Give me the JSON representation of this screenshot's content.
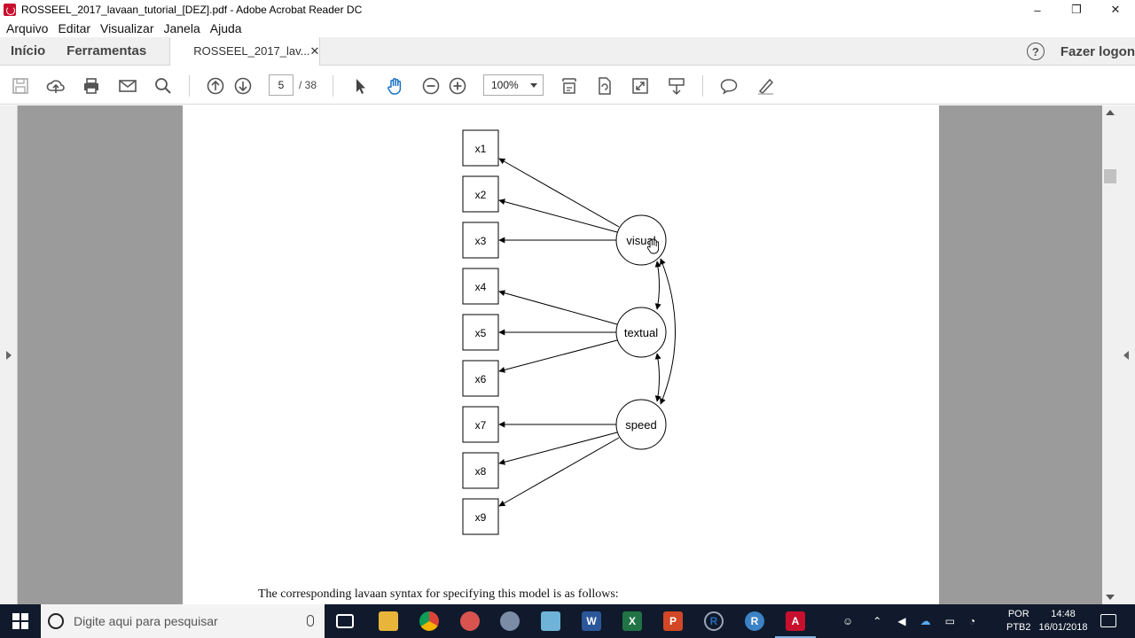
{
  "window": {
    "title": "ROSSEEL_2017_lavaan_tutorial_[DEZ].pdf - Adobe Acrobat Reader DC",
    "minimize": "–",
    "restore": "❐",
    "close": "✕"
  },
  "menu": {
    "items": [
      "Arquivo",
      "Editar",
      "Visualizar",
      "Janela",
      "Ajuda"
    ]
  },
  "tabs": {
    "home": "Início",
    "tools": "Ferramentas",
    "document": "ROSSEEL_2017_lav...",
    "close_glyph": "✕",
    "help": "?",
    "login": "Fazer logon"
  },
  "toolbar": {
    "current_page": "5",
    "total_pages": "/ 38",
    "zoom": "100%",
    "icons": [
      "save-icon",
      "upload-icon",
      "print-icon",
      "email-icon",
      "search-icon",
      "page-up-icon",
      "page-down-icon",
      "select-cursor-icon",
      "hand-icon",
      "zoom-out-icon",
      "zoom-in-icon",
      "fit-page-icon",
      "rotate-icon",
      "fullscreen-icon",
      "scroll-mode-icon",
      "comment-icon",
      "highlight-pen-icon"
    ]
  },
  "diagram": {
    "indicators": [
      "x1",
      "x2",
      "x3",
      "x4",
      "x5",
      "x6",
      "x7",
      "x8",
      "x9"
    ],
    "latents": [
      "visual",
      "textual",
      "speed"
    ],
    "loadings": [
      {
        "from": "visual",
        "to": [
          "x1",
          "x2",
          "x3"
        ]
      },
      {
        "from": "textual",
        "to": [
          "x4",
          "x5",
          "x6"
        ]
      },
      {
        "from": "speed",
        "to": [
          "x7",
          "x8",
          "x9"
        ]
      }
    ],
    "covariances": [
      [
        "visual",
        "textual"
      ],
      [
        "textual",
        "speed"
      ],
      [
        "visual",
        "speed"
      ]
    ]
  },
  "caption": "The corresponding lavaan syntax for specifying this model is as follows:",
  "taskbar": {
    "search_placeholder": "Digite aqui para pesquisar",
    "apps": [
      "task-view-icon",
      "file-explorer-icon",
      "chrome-icon",
      "app-icon-1",
      "app-icon-2",
      "app-icon-3",
      "word-icon",
      "excel-icon",
      "powerpoint-icon",
      "r-icon",
      "rstudio-icon",
      "acrobat-icon"
    ],
    "lang_top": "POR",
    "lang_bottom": "PTB2",
    "time": "14:48",
    "date": "16/01/2018"
  },
  "colors": {
    "workspace": "#9b9b9b",
    "taskbar": "#101a2c",
    "acrobat_red": "#c8102e"
  }
}
